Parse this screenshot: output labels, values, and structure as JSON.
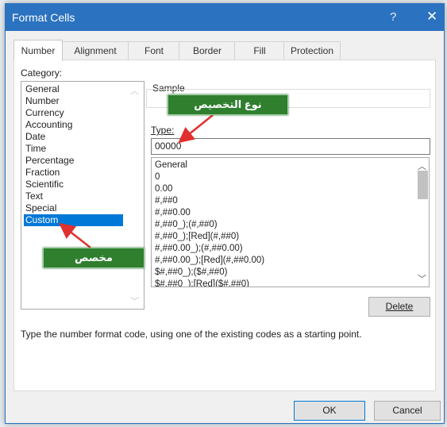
{
  "window": {
    "title": "Format Cells",
    "help_icon": "?",
    "close_icon": "✕"
  },
  "tabs": [
    "Number",
    "Alignment",
    "Font",
    "Border",
    "Fill",
    "Protection"
  ],
  "active_tab": "Number",
  "category": {
    "label": "Category:",
    "items": [
      "General",
      "Number",
      "Currency",
      "Accounting",
      "Date",
      "Time",
      "Percentage",
      "Fraction",
      "Scientific",
      "Text",
      "Special",
      "Custom"
    ],
    "selected": "Custom"
  },
  "sample": {
    "label": "Sample"
  },
  "type": {
    "label": "Type:",
    "value": "00000"
  },
  "formats": [
    "General",
    "0",
    "0.00",
    "#,##0",
    "#,##0.00",
    "#,##0_);(#,##0)",
    "#,##0_);[Red](#,##0)",
    "#,##0.00_);(#,##0.00)",
    "#,##0.00_);[Red](#,##0.00)",
    "$#,##0_);($#,##0)",
    "$#,##0_);[Red]($#,##0)"
  ],
  "buttons": {
    "delete": "Delete",
    "ok": "OK",
    "cancel": "Cancel"
  },
  "description": "Type the number format code, using one of the existing codes as a starting point.",
  "annotations": {
    "type_callout": "نوع التخصيص",
    "custom_callout": "مخصص"
  },
  "colors": {
    "accent": "#2b72c0",
    "selection": "#0078d7",
    "callout": "#2f7f2f",
    "arrow": "#e03030"
  }
}
